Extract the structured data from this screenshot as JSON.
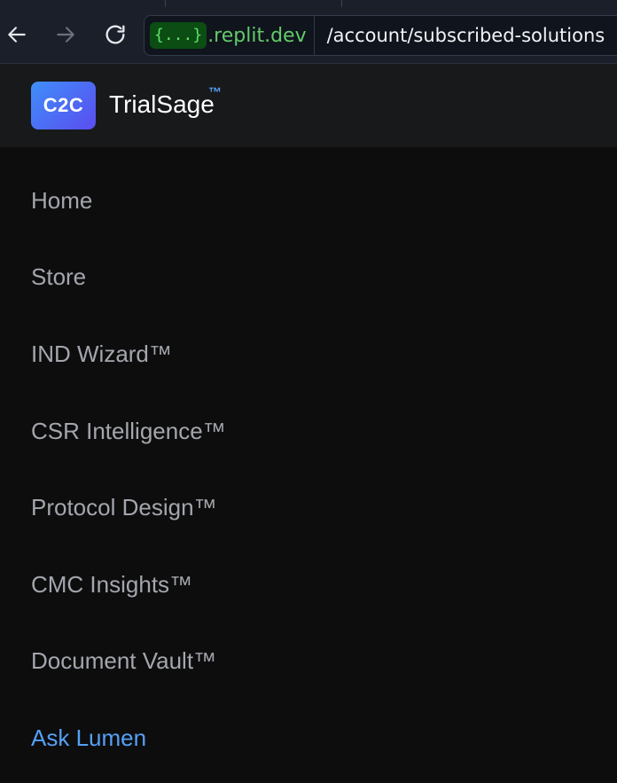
{
  "browser": {
    "origin_badge": "{...}",
    "origin_domain": ".replit.dev",
    "path": "/account/subscribed-solutions"
  },
  "header": {
    "logo_text": "C2C",
    "brand_name": "TrialSage",
    "brand_tm": "™"
  },
  "menu": {
    "items": [
      {
        "label": "Home"
      },
      {
        "label": "Store"
      },
      {
        "label": "IND Wizard™"
      },
      {
        "label": "CSR Intelligence™"
      },
      {
        "label": "Protocol Design™"
      },
      {
        "label": "CMC Insights™"
      },
      {
        "label": "Document Vault™"
      },
      {
        "label": "Ask Lumen"
      }
    ]
  },
  "colors": {
    "accent": "#55a0f7",
    "menu_text": "#a3a6ad",
    "background": "#0d0d0d",
    "header_background": "#18191b"
  }
}
